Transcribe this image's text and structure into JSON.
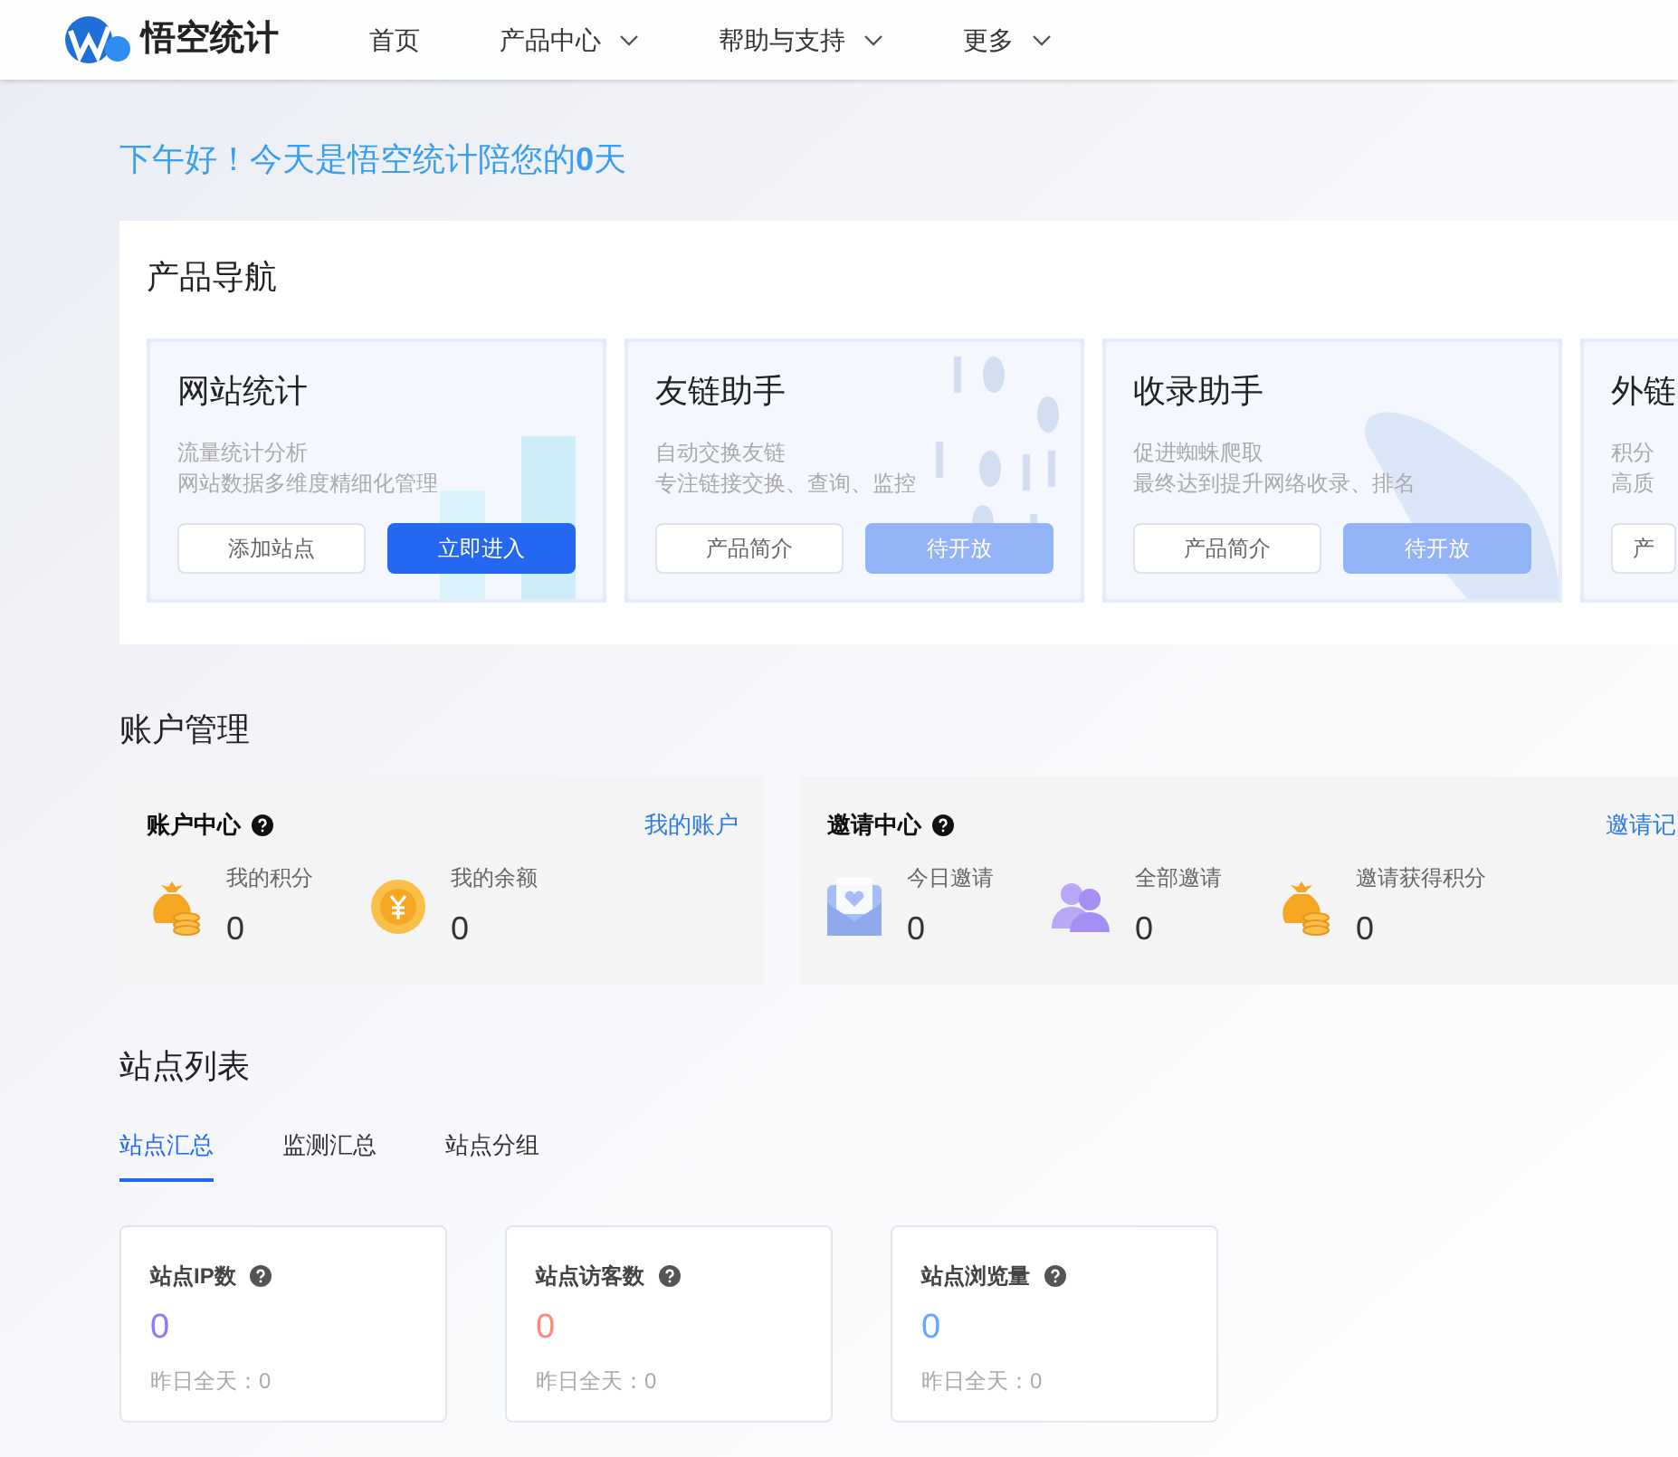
{
  "header": {
    "brand": "悟空统计",
    "nav": [
      {
        "label": "首页",
        "has_dropdown": false
      },
      {
        "label": "产品中心",
        "has_dropdown": true
      },
      {
        "label": "帮助与支持",
        "has_dropdown": true
      },
      {
        "label": "更多",
        "has_dropdown": true
      }
    ]
  },
  "greeting": {
    "text": "下午好！今天是悟空统计陪您的",
    "days": "0",
    "unit": "天"
  },
  "product_nav": {
    "title": "产品导航",
    "cards": [
      {
        "title": "网站统计",
        "lines": [
          "流量统计分析",
          "网站数据多维度精细化管理"
        ],
        "buttons": [
          {
            "label": "添加站点",
            "kind": "outline"
          },
          {
            "label": "立即进入",
            "kind": "primary"
          }
        ]
      },
      {
        "title": "友链助手",
        "lines": [
          "自动交换友链",
          "专注链接交换、查询、监控"
        ],
        "buttons": [
          {
            "label": "产品简介",
            "kind": "outline"
          },
          {
            "label": "待开放",
            "kind": "disabled"
          }
        ]
      },
      {
        "title": "收录助手",
        "lines": [
          "促进蜘蛛爬取",
          "最终达到提升网络收录、排名"
        ],
        "buttons": [
          {
            "label": "产品简介",
            "kind": "outline"
          },
          {
            "label": "待开放",
            "kind": "disabled"
          }
        ]
      },
      {
        "title": "外链",
        "lines": [
          "积分",
          "高质"
        ],
        "buttons": [
          {
            "label": "产",
            "kind": "outline"
          }
        ]
      }
    ]
  },
  "account": {
    "title": "账户管理",
    "panels": [
      {
        "title": "账户中心",
        "link": "我的账户",
        "items": [
          {
            "label": "我的积分",
            "value": "0",
            "kind": "bag"
          },
          {
            "label": "我的余额",
            "value": "0",
            "kind": "coin"
          }
        ]
      },
      {
        "title": "邀请中心",
        "link": "邀请记",
        "items": [
          {
            "label": "今日邀请",
            "value": "0",
            "kind": "envelope"
          },
          {
            "label": "全部邀请",
            "value": "0",
            "kind": "people"
          },
          {
            "label": "邀请获得积分",
            "value": "0",
            "kind": "bag"
          }
        ]
      }
    ]
  },
  "sites": {
    "title": "站点列表",
    "tabs": [
      {
        "label": "站点汇总",
        "selected": true
      },
      {
        "label": "监测汇总",
        "selected": false
      },
      {
        "label": "站点分组",
        "selected": false
      }
    ],
    "stats": [
      {
        "label": "站点IP数",
        "value": "0",
        "color": "#8b7cff",
        "footer": "昨日全天：0"
      },
      {
        "label": "站点访客数",
        "value": "0",
        "color": "#f98b7b",
        "footer": "昨日全天：0"
      },
      {
        "label": "站点浏览量",
        "value": "0",
        "color": "#6aa6ff",
        "footer": "昨日全天：0"
      }
    ]
  }
}
